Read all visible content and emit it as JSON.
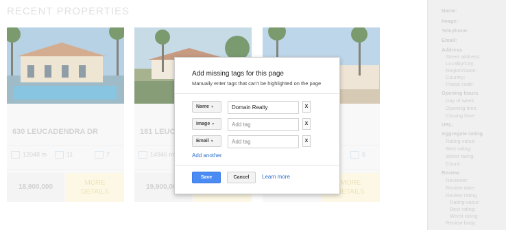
{
  "page": {
    "section_title": "RECENT PROPERTIES",
    "cards": [
      {
        "address": "630 LEUCADENDRA DR",
        "area": "12048",
        "area_unit": "m",
        "baths": "11",
        "beds": "7",
        "price": "18,900,000",
        "more_line1": "MORE",
        "more_line2": "DETAILS"
      },
      {
        "address": "181 LEUCA",
        "area": "14946",
        "area_unit": "m",
        "baths": "",
        "beds": "",
        "price": "19,900,000",
        "more_line1": "",
        "more_line2": ""
      },
      {
        "address": "",
        "area": "",
        "area_unit": "",
        "baths": "",
        "beds": "6",
        "price": "",
        "more_line1": "MORE",
        "more_line2": "DETAILS"
      }
    ]
  },
  "sidebar": {
    "items": [
      {
        "label": "Name:"
      },
      {
        "label": "Image:"
      },
      {
        "label": "Telephone:"
      },
      {
        "label": "Email:"
      },
      {
        "label": "Address"
      },
      {
        "label": "Street address:"
      },
      {
        "label": "Locality/City:"
      },
      {
        "label": "Region/State:"
      },
      {
        "label": "Country:"
      },
      {
        "label": "Postal code:"
      },
      {
        "label": "Opening hours"
      },
      {
        "label": "Day of week:"
      },
      {
        "label": "Opening time:"
      },
      {
        "label": "Closing time:"
      },
      {
        "label": "URL:"
      },
      {
        "label": "Aggregate rating"
      },
      {
        "label": "Rating value:"
      },
      {
        "label": "Best rating:"
      },
      {
        "label": "Worst rating:"
      },
      {
        "label": "Count:"
      },
      {
        "label": "Review"
      },
      {
        "label": "Reviewer:"
      },
      {
        "label": "Review date:"
      },
      {
        "label": "Review rating"
      },
      {
        "label": "Rating value:"
      },
      {
        "label": "Best rating:"
      },
      {
        "label": "Worst rating:"
      },
      {
        "label": "Review body:"
      }
    ]
  },
  "modal": {
    "title": "Add missing tags for this page",
    "subtitle": "Manually enter tags that can't be highlighted on the page",
    "rows": [
      {
        "tag": "Name",
        "value": "Domain Realty",
        "placeholder": "Add tag",
        "remove": "X"
      },
      {
        "tag": "Image",
        "value": "",
        "placeholder": "Add tag",
        "remove": "X"
      },
      {
        "tag": "Email",
        "value": "",
        "placeholder": "Add tag",
        "remove": "X"
      }
    ],
    "add_another": "Add another",
    "save_label": "Save",
    "cancel_label": "Cancel",
    "learn_more": "Learn more"
  },
  "colors": {
    "accent": "#4b8bf4",
    "link": "#2b6fc9",
    "more_details_bg": "#fcf6dc"
  }
}
